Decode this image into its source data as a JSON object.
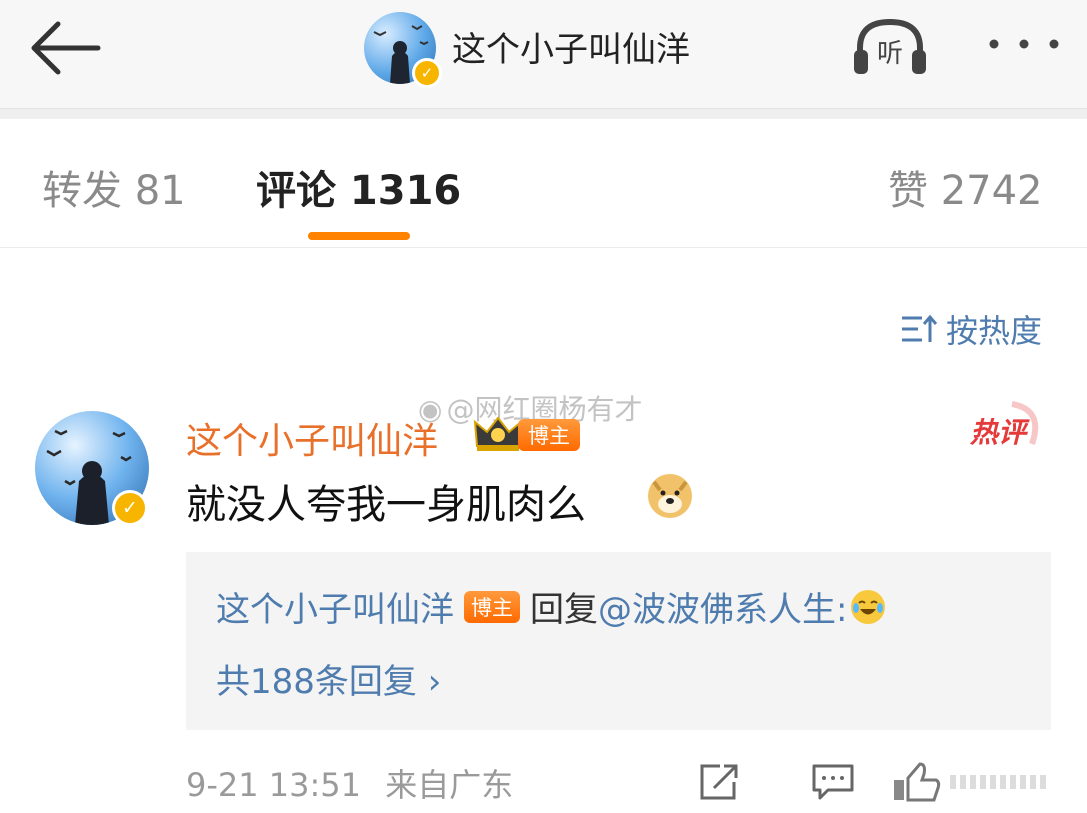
{
  "header": {
    "title": "这个小子叫仙洋",
    "listen_label": "听"
  },
  "tabs": [
    {
      "label": "转发 81"
    },
    {
      "label": "评论 1316"
    },
    {
      "label": "赞 2742"
    }
  ],
  "sort": {
    "label": "按热度"
  },
  "watermark": "@网红圈杨有才",
  "comment": {
    "author": "这个小子叫仙洋",
    "author_badge": "博主",
    "hot_label": "热评",
    "text": "就没人夸我一身肌肉么",
    "reply": {
      "author": "这个小子叫仙洋",
      "author_badge": "博主",
      "text": "回复",
      "mention": "@波波佛系人生:",
      "count_text": "共188条回复 ›"
    },
    "time": "9-21 13:51",
    "source": "来自广东"
  },
  "colors": {
    "accent": "#ff8200",
    "link": "#4f7cae",
    "author": "#e8702a",
    "verified": "#f7b500"
  }
}
